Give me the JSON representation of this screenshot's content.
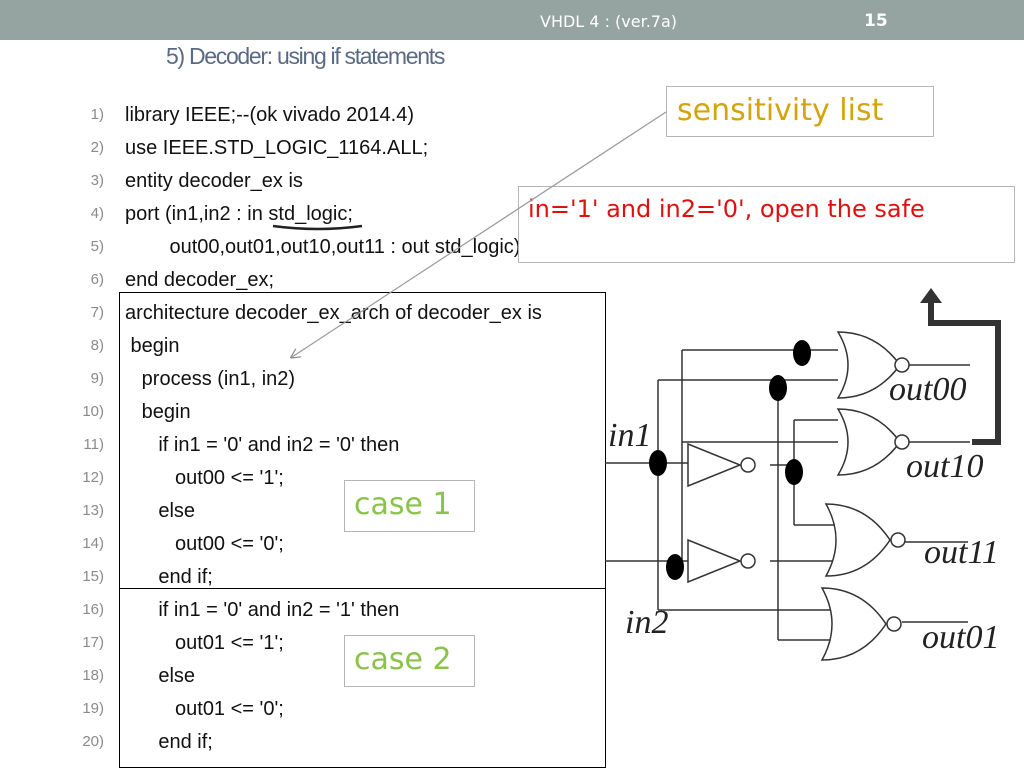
{
  "header": {
    "title": "VHDL 4 : (ver.7a)",
    "page_number": "15"
  },
  "slide_title": "5) Decoder: using if statements",
  "code_lines": [
    {
      "num": "1)",
      "text": "library IEEE;--(ok vivado 2014.4)"
    },
    {
      "num": "2)",
      "text": "use IEEE.STD_LOGIC_1164.ALL;"
    },
    {
      "num": "3)",
      "text": "entity decoder_ex is"
    },
    {
      "num": "4)",
      "text": "port (in1,in2 : in std_logic;"
    },
    {
      "num": "5)",
      "text": "        out00,out01,out10,out11 : out std_logic);"
    },
    {
      "num": "6)",
      "text": "end decoder_ex;"
    },
    {
      "num": "7)",
      "text": "architecture decoder_ex_arch of decoder_ex is"
    },
    {
      "num": "8)",
      "text": " begin"
    },
    {
      "num": "9)",
      "text": "   process (in1, in2)"
    },
    {
      "num": "10)",
      "text": "   begin"
    },
    {
      "num": "11)",
      "text": "      if in1 = '0' and in2 = '0' then"
    },
    {
      "num": "12)",
      "text": "         out00 <= '1';"
    },
    {
      "num": "13)",
      "text": "      else"
    },
    {
      "num": "14)",
      "text": "         out00 <= '0';"
    },
    {
      "num": "15)",
      "text": "      end if;"
    },
    {
      "num": "16)",
      "text": "      if in1 = '0' and in2 = '1' then"
    },
    {
      "num": "17)",
      "text": "         out01 <= '1';"
    },
    {
      "num": "18)",
      "text": "      else"
    },
    {
      "num": "19)",
      "text": "         out01 <= '0';"
    },
    {
      "num": "20)",
      "text": "      end if;"
    }
  ],
  "callouts": {
    "sensitivity": "sensitivity list",
    "safe": "in='1' and in2='0', open the safe",
    "case1": "case 1",
    "case2": "case 2"
  },
  "circuit": {
    "in1": "in1",
    "in2": "in2",
    "out00": "out00",
    "out10": "out10",
    "out11": "out11",
    "out01": "out01"
  },
  "colors": {
    "topbar": "#95a4a0",
    "title": "#5a6a85",
    "sensitivity_text": "#d4a40c",
    "safe_text": "#e01010",
    "case_text": "#8bc34a"
  }
}
